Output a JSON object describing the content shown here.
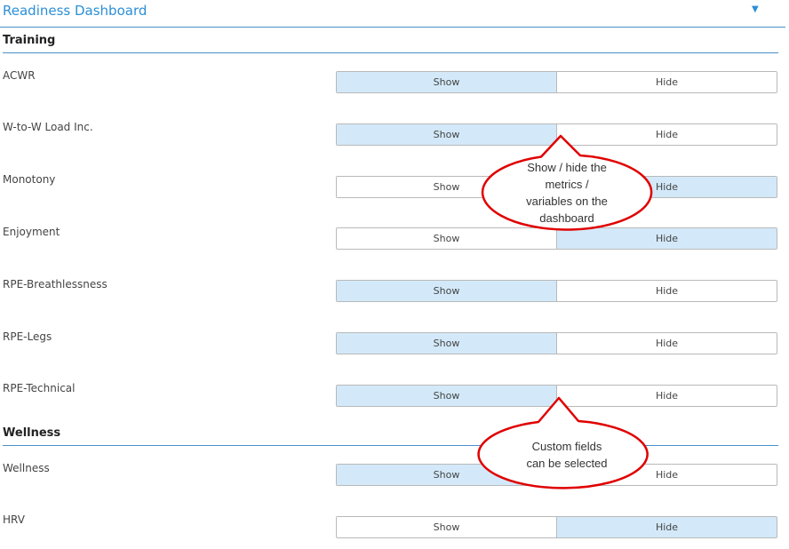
{
  "header": {
    "title": "Readiness Dashboard",
    "caret_icon": "caret-down-icon"
  },
  "sections": [
    {
      "heading": "Training"
    },
    {
      "heading": "Wellness"
    }
  ],
  "rows": [
    {
      "label": "ACWR",
      "show": "Show",
      "hide": "Hide",
      "selected": "Show"
    },
    {
      "label": "W-to-W Load Inc.",
      "show": "Show",
      "hide": "Hide",
      "selected": "Show"
    },
    {
      "label": "Monotony",
      "show": "Show",
      "hide": "Hide",
      "selected": "Hide"
    },
    {
      "label": "Enjoyment",
      "show": "Show",
      "hide": "Hide",
      "selected": "Hide"
    },
    {
      "label": "RPE-Breathlessness",
      "show": "Show",
      "hide": "Hide",
      "selected": "Show"
    },
    {
      "label": "RPE-Legs",
      "show": "Show",
      "hide": "Hide",
      "selected": "Show"
    },
    {
      "label": "RPE-Technical",
      "show": "Show",
      "hide": "Hide",
      "selected": "Show"
    },
    {
      "label": "Wellness",
      "show": "Show",
      "hide": "Hide",
      "selected": "Show"
    },
    {
      "label": "HRV",
      "show": "Show",
      "hide": "Hide",
      "selected": "Hide"
    }
  ],
  "callouts": [
    {
      "line1": "Show / hide the",
      "line2": "metrics /",
      "line3": "variables on the",
      "line4": "dashboard"
    },
    {
      "line1": "Custom fields",
      "line2": "can be selected"
    }
  ],
  "colors": {
    "accent": "#2b8fd6",
    "selected": "#d3e9f9",
    "callout": "#e00000"
  }
}
